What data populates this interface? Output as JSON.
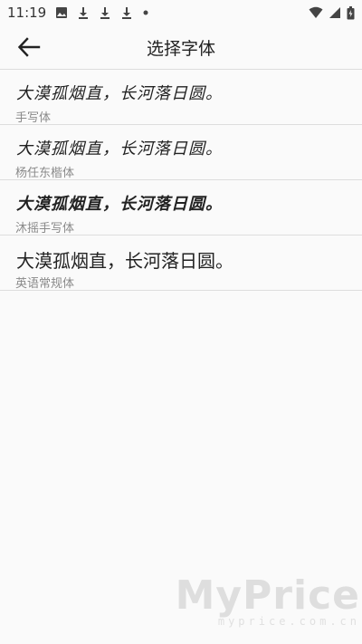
{
  "status_bar": {
    "time": "11:19",
    "icons": [
      "image-icon",
      "download-icon",
      "download-icon",
      "download-icon",
      "dot-icon",
      "wifi-icon",
      "signal-icon",
      "battery-icon"
    ]
  },
  "app_bar": {
    "title": "选择字体"
  },
  "fonts": [
    {
      "sample": "大漠孤烟直，长河落日圆。",
      "name": "手写体"
    },
    {
      "sample": "大漠孤烟直，长河落日圆。",
      "name": "杨任东楷体"
    },
    {
      "sample": "大漠孤烟直，长河落日圆。",
      "name": "沐摇手写体"
    },
    {
      "sample": "大漠孤烟直，长河落日圆。",
      "name": "英语常规体"
    }
  ],
  "watermark": {
    "main": "MyPrice",
    "sub": "myprice.com.cn"
  }
}
